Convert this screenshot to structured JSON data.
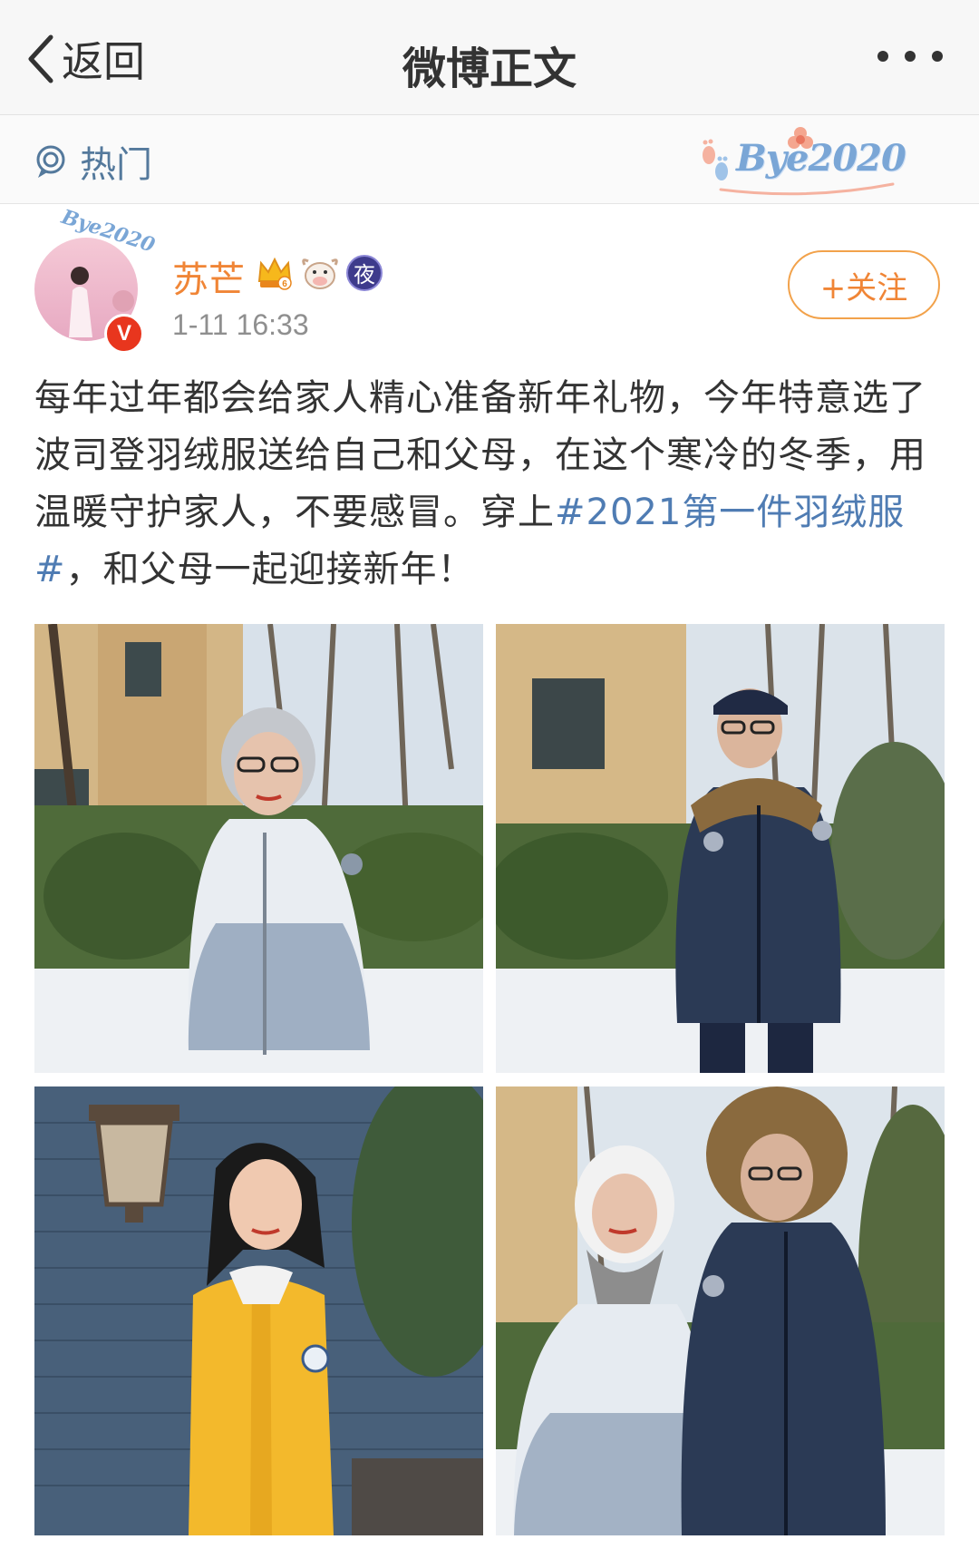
{
  "nav": {
    "back_label": "返回",
    "title": "微博正文",
    "back_icon": "chevron-left-icon",
    "more_icon": "more-dots-icon"
  },
  "hot_bar": {
    "label": "热门",
    "icon": "hot-topic-icon",
    "badge_text": "Bye2020"
  },
  "post": {
    "author": "苏芒",
    "time": "1-11 16:33",
    "follow_label": "+关注",
    "text_before_topic1": "每年过年都会给家人精心准备新年礼物，今年特意选了波司登羽绒服送给自己和父母，在这个寒冷的冬季，用温暖守护家人，不要感冒。穿上",
    "topic": "#2021第一件羽绒服#",
    "text_after_topic": "，和父母一起迎接新年！",
    "badges": [
      "crown-badge-icon",
      "ox-badge-icon",
      "night-badge-icon"
    ],
    "night_badge_text": "夜",
    "verified_badge_text": "V",
    "avatar_badge_text": "Bye2020"
  },
  "colors": {
    "username": "#f08536",
    "topic_link": "#4f7cb3",
    "hot_label": "#54799c",
    "follow_border": "#f2a24b",
    "verified": "#e8361e"
  },
  "photos": [
    {
      "subject": "elderly woman in white gradient down jacket"
    },
    {
      "subject": "elderly man in navy camouflage parka with fur hood"
    },
    {
      "subject": "woman in yellow down jacket by brick wall"
    },
    {
      "subject": "elderly couple in down jackets"
    }
  ]
}
